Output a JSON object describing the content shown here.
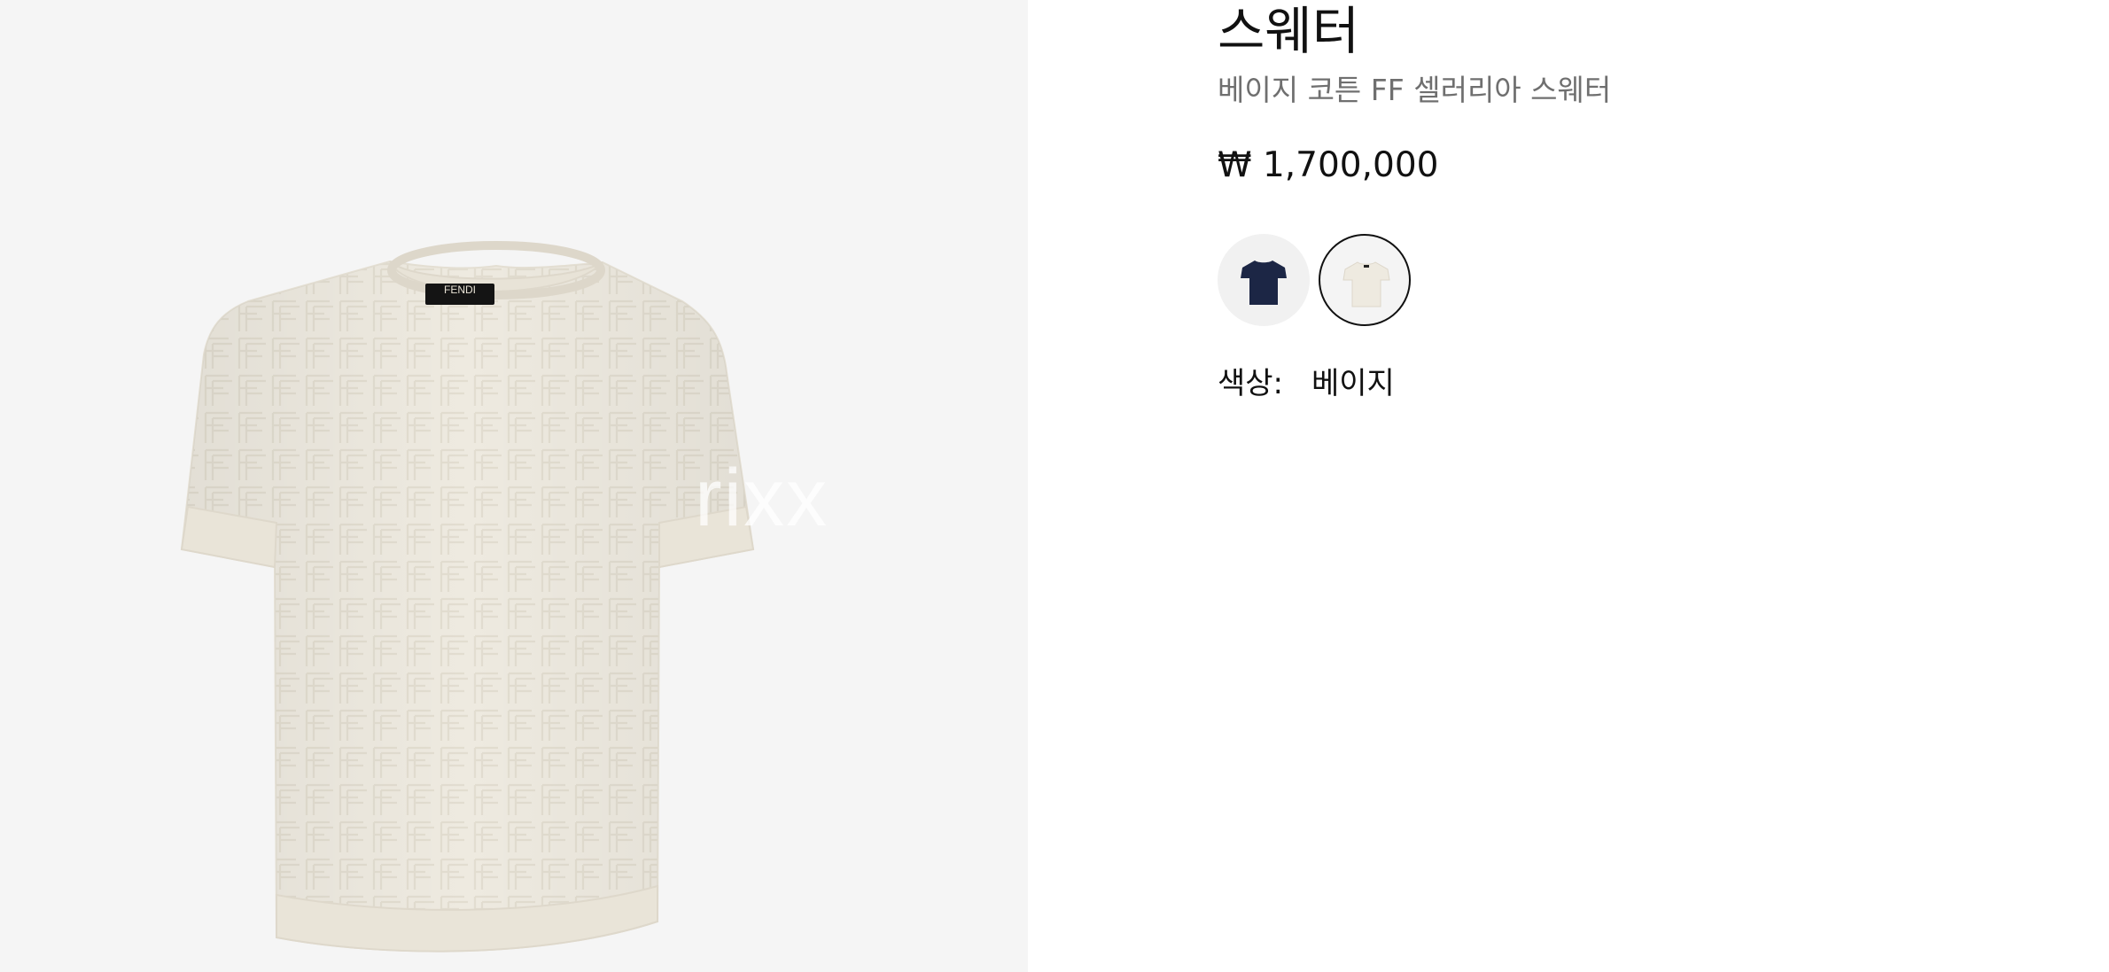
{
  "product": {
    "title": "스웨터",
    "subtitle": "베이지 코튼 FF 셀러리아 스웨터",
    "price": "₩ 1,700,000",
    "label_brand": "FENDI",
    "watermark": "rixx"
  },
  "swatches": [
    {
      "name": "navy",
      "color": "#1c2645",
      "selected": false
    },
    {
      "name": "beige",
      "color": "#eeeae0",
      "selected": true
    }
  ],
  "color_selection": {
    "label": "색상:",
    "value": "베이지"
  },
  "colors": {
    "image_background": "#f5f5f5",
    "garment": "#eeeae0",
    "text_primary": "#111111",
    "text_secondary": "#6f6f6f"
  }
}
